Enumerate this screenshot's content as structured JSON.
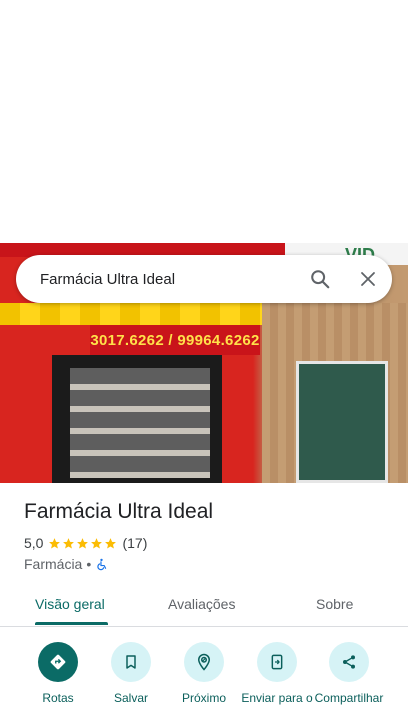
{
  "search": {
    "query": "Farmácia Ultra Ideal"
  },
  "photo": {
    "phone_text": "3017.6262 / 99964.6262"
  },
  "place": {
    "name": "Farmácia Ultra Ideal",
    "rating": "5,0",
    "stars": 5,
    "review_count": "(17)",
    "category": "Farmácia",
    "separator": "•"
  },
  "tabs": [
    {
      "label": "Visão geral",
      "active": true
    },
    {
      "label": "Avaliações",
      "active": false
    },
    {
      "label": "Sobre",
      "active": false
    }
  ],
  "actions": [
    {
      "label": "Rotas",
      "icon": "directions-icon"
    },
    {
      "label": "Salvar",
      "icon": "bookmark-icon"
    },
    {
      "label": "Próximo",
      "icon": "nearby-icon"
    },
    {
      "label": "Enviar para o",
      "icon": "send-to-phone-icon"
    },
    {
      "label": "Compartilhar",
      "icon": "share-icon"
    }
  ],
  "colors": {
    "accent": "#0b6b66",
    "chip_bg": "#d6f3f6",
    "star": "#fbbc04"
  }
}
